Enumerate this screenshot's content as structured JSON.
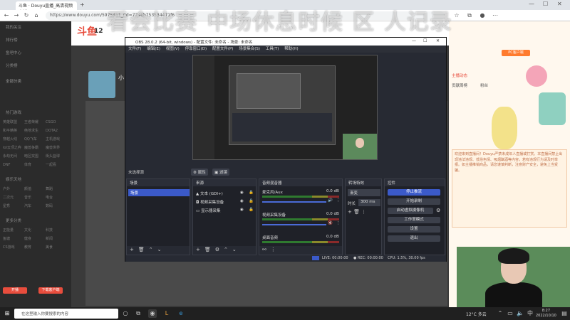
{
  "browser": {
    "tab_title": "斗鱼 · Douyu直播_高清视频直播",
    "url": "https://www.douyu.com/5975451_rid=7248b753534471f6",
    "colors": {
      "accent": "#e84d3d"
    }
  },
  "overlay": {
    "title": "看会比赛 中场休息时候 区 人记录"
  },
  "douyu": {
    "logo": "斗鱼",
    "left_nav": [
      "我的关注",
      "排行榜",
      "鱼吧中心",
      "分类榜"
    ],
    "section_all": "全部分类",
    "section_hot": "热门游戏",
    "games_rows": [
      [
        "英雄联盟",
        "王者荣耀",
        "CSGO"
      ],
      [
        "和平精英",
        "绝地求生",
        "DOTA2"
      ],
      [
        "穿越火线",
        "QQ飞车",
        "主机游戏"
      ],
      [
        "lol云顶之弈",
        "魔兽争霸",
        "魔兽世界"
      ],
      [
        "永劫无间",
        "暗区突围",
        "街头篮球"
      ],
      [
        "DNF",
        "体育",
        "一起看"
      ]
    ],
    "section_ent": "娱乐天地",
    "ent_rows": [
      [
        "户外",
        "颜值",
        "舞蹈"
      ],
      [
        "二次元",
        "音乐",
        "电台"
      ],
      [
        "星秀",
        "汽车",
        "数码"
      ]
    ],
    "section_more": "更多分类",
    "more_rows": [
      [
        "正能量",
        "文化",
        "科技"
      ],
      [
        "鱼塘",
        "健身",
        "新闻"
      ],
      [
        "CS游戏",
        "教育",
        "美食"
      ]
    ],
    "bottom_btns": [
      "开播",
      "下载客户端"
    ],
    "room_level": "12",
    "streamer_name": "小",
    "right_panel": {
      "top_btn": "PC客户端",
      "tab1": "主播动态",
      "tab2": "贡献周榜",
      "tab3": "粉丝",
      "notice": "欢迎来到直播间！Douyu严禁未成年人直播或打赏。本直播间禁止出现违法违规、低俗色情、吸烟酗酒等内容，若有违规行为请及时举报。如主播推销商品，请您谨慎判断，注意财产安全，避免上当受骗。"
    }
  },
  "obs": {
    "window_title": "OBS 28.0.2 (64-bit, windows) - 配置文件: 未命名 - 场景: 未命名",
    "menus": [
      "文件(F)",
      "编辑(E)",
      "视图(V)",
      "停靠窗口(D)",
      "配置文件(P)",
      "场景集合(S)",
      "工具(T)",
      "帮助(H)"
    ],
    "scene_label": "未选择源",
    "props_btn": "属性",
    "filter_btn": "滤镜",
    "docks": {
      "scenes": {
        "title": "场景",
        "items": [
          "场景"
        ]
      },
      "sources": {
        "title": "来源",
        "items": [
          "文本 (GDI+)",
          "视频采集设备",
          "显示器采集"
        ]
      },
      "mixer": {
        "title": "音频混音器",
        "channels": [
          {
            "name": "麦克风/Aux",
            "db": "0.0 dB"
          },
          {
            "name": "视频采集设备",
            "db": "0.0 dB"
          },
          {
            "name": "桌面音频",
            "db": "0.0 dB"
          }
        ]
      },
      "transitions": {
        "title": "转场特效",
        "type": "渐变",
        "duration_label": "时长",
        "duration": "300 ms"
      },
      "controls": {
        "title": "控件",
        "buttons": [
          "停止推流",
          "开始录制",
          "启动虚拟摄像机",
          "工作室模式",
          "设置",
          "退出"
        ]
      }
    },
    "status": {
      "live": "LIVE: 00:00:00",
      "rec": "REC: 00:00:00",
      "cpu": "CPU: 1.5%, 30.00 fps"
    }
  },
  "taskbar": {
    "search_placeholder": "在这里输入你要搜索的内容",
    "weather": "12°C  多云",
    "time": "8:27",
    "date": "2022/10/10"
  }
}
